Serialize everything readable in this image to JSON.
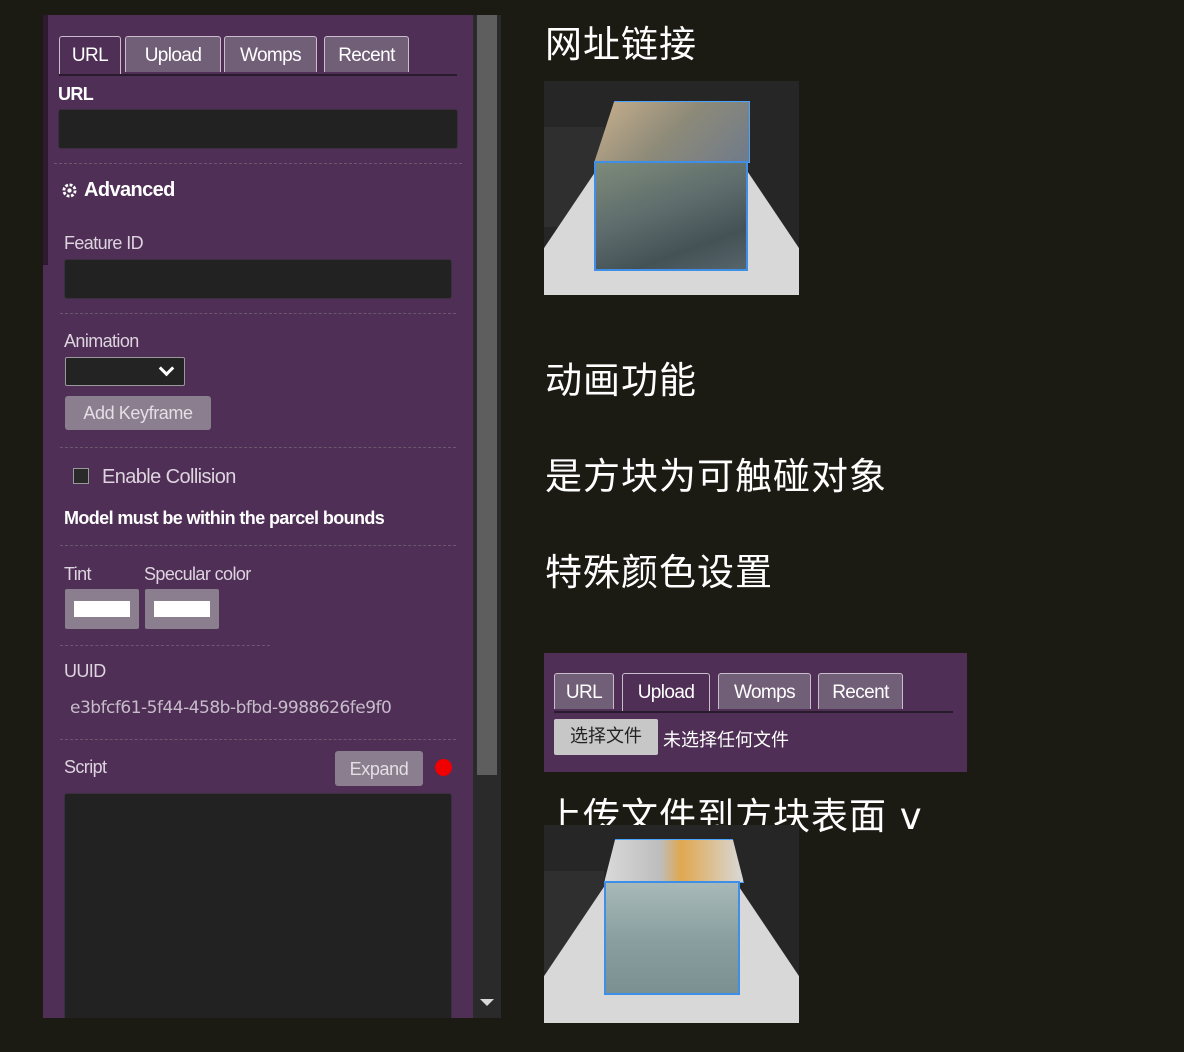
{
  "editor": {
    "tabs": [
      "URL",
      "Upload",
      "Womps",
      "Recent"
    ],
    "active_tab": "URL",
    "url_label": "URL",
    "url_value": "",
    "advanced_label": "Advanced",
    "feature_id_label": "Feature ID",
    "feature_id_value": "",
    "animation_label": "Animation",
    "animation_value": "",
    "add_keyframe_label": "Add Keyframe",
    "collision_label": "Enable Collision",
    "collision_checked": false,
    "collision_note": "Model must be within the parcel bounds",
    "tint_label": "Tint",
    "specular_label": "Specular color",
    "tint_color": "#ffffff",
    "specular_color": "#ffffff",
    "uuid_label": "UUID",
    "uuid_value": "e3bfcf61-5f44-458b-bfbd-9988626fe9f0",
    "script_label": "Script",
    "expand_label": "Expand",
    "script_value": "",
    "status_dot_color": "#f00000"
  },
  "annotations": {
    "url_link": "网址链接",
    "animation": "动画功能",
    "collision": "是方块为可触碰对象",
    "color": "特殊颜色设置",
    "upload": "上传文件到方块表面 v"
  },
  "upload_panel": {
    "tabs": [
      "URL",
      "Upload",
      "Womps",
      "Recent"
    ],
    "active_tab": "Upload",
    "choose_file_label": "选择文件",
    "no_file_label": "未选择任何文件"
  },
  "colors": {
    "panel_bg": "#4f2f55",
    "page_bg": "#1b1a13",
    "selection_outline": "#3f8ee8"
  }
}
